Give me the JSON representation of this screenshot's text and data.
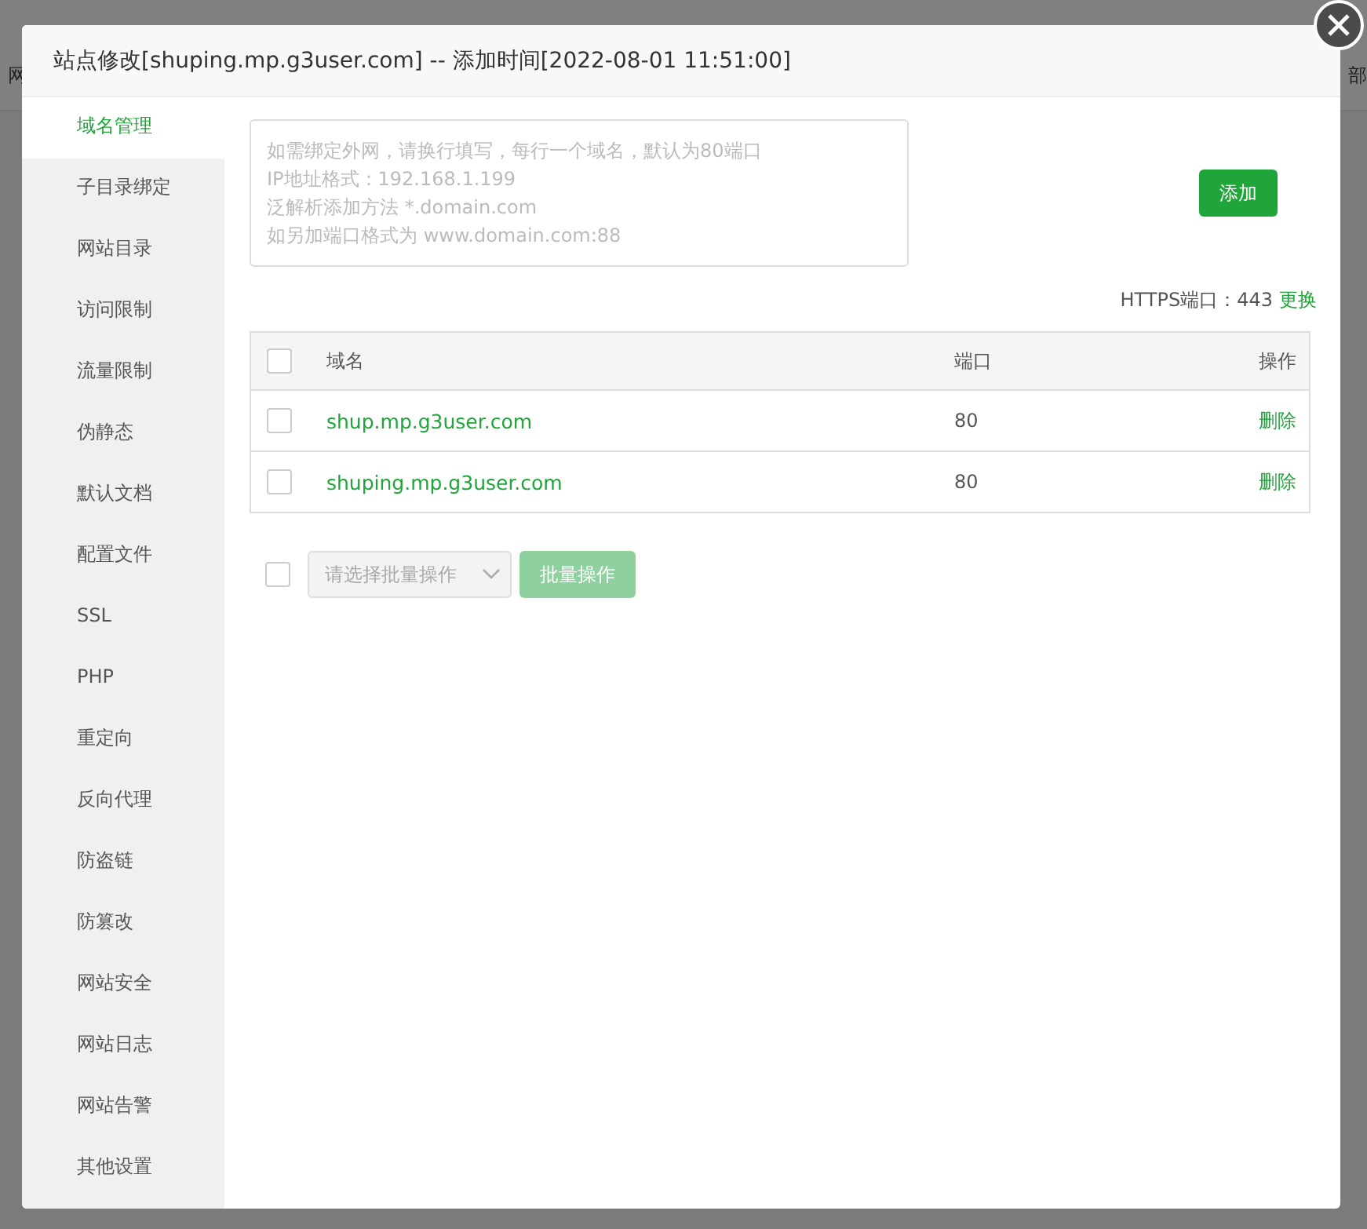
{
  "background": {
    "left_text": "网",
    "right_text": "部"
  },
  "dialog": {
    "title": "站点修改[shuping.mp.g3user.com] -- 添加时间[2022-08-01 11:51:00]"
  },
  "sidebar": {
    "items": [
      {
        "label": "域名管理",
        "selected": true
      },
      {
        "label": "子目录绑定",
        "selected": false
      },
      {
        "label": "网站目录",
        "selected": false
      },
      {
        "label": "访问限制",
        "selected": false
      },
      {
        "label": "流量限制",
        "selected": false
      },
      {
        "label": "伪静态",
        "selected": false
      },
      {
        "label": "默认文档",
        "selected": false
      },
      {
        "label": "配置文件",
        "selected": false
      },
      {
        "label": "SSL",
        "selected": false
      },
      {
        "label": "PHP",
        "selected": false
      },
      {
        "label": "重定向",
        "selected": false
      },
      {
        "label": "反向代理",
        "selected": false
      },
      {
        "label": "防盗链",
        "selected": false
      },
      {
        "label": "防篡改",
        "selected": false
      },
      {
        "label": "网站安全",
        "selected": false
      },
      {
        "label": "网站日志",
        "selected": false
      },
      {
        "label": "网站告警",
        "selected": false
      },
      {
        "label": "其他设置",
        "selected": false
      }
    ]
  },
  "domain_input": {
    "placeholder": "如需绑定外网，请换行填写，每行一个域名，默认为80端口\nIP地址格式：192.168.1.199\n泛解析添加方法 *.domain.com\n如另加端口格式为 www.domain.com:88"
  },
  "add_button": "添加",
  "https": {
    "label": "HTTPS端口：443",
    "link": "更换"
  },
  "table": {
    "header_checked": false,
    "columns": [
      "域名",
      "端口",
      "操作"
    ],
    "rows": [
      {
        "checked": false,
        "domain": "shup.mp.g3user.com",
        "port": "80",
        "action": "删除"
      },
      {
        "checked": false,
        "domain": "shuping.mp.g3user.com",
        "port": "80",
        "action": "删除"
      }
    ]
  },
  "batch": {
    "checked": false,
    "select_placeholder": "请选择批量操作",
    "button": "批量操作",
    "disabled": true
  }
}
